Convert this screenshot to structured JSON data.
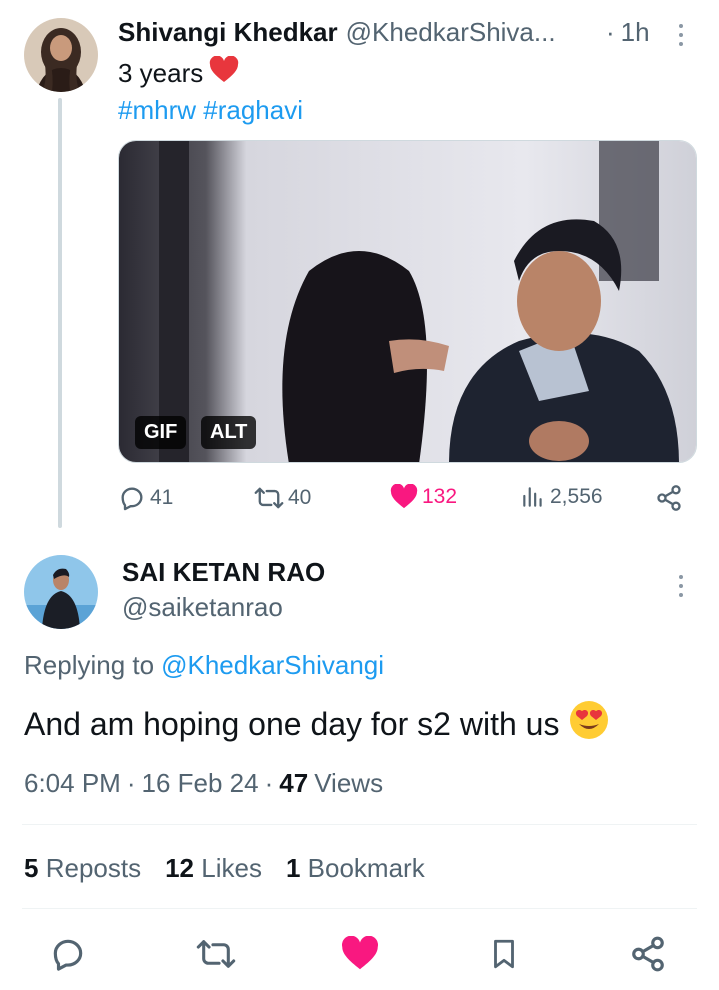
{
  "parent_tweet": {
    "author_name": "Shivangi Khedkar",
    "author_handle": "@KhedkarShiva...",
    "separator": "·",
    "time_ago": "1h",
    "text": "3 years",
    "emoji_heart": "❤️",
    "hashtags": "#mhrw #raghavi",
    "media_badges": {
      "gif": "GIF",
      "alt": "ALT"
    },
    "actions": {
      "replies": "41",
      "reposts": "40",
      "likes": "132",
      "views": "2,556"
    },
    "liked": true
  },
  "reply_tweet": {
    "author_name": "SAI KETAN RAO",
    "author_handle": "@saiketanrao",
    "replying_prefix": "Replying to",
    "replying_handle": "@KhedkarShivangi",
    "text": "And am hoping one day for s2 with us",
    "emoji": "😍",
    "time": "6:04 PM",
    "sep1": "·",
    "date": "16 Feb 24",
    "sep2": "·",
    "views_count": "47",
    "views_label": "Views",
    "stats": {
      "reposts_count": "5",
      "reposts_label": "Reposts",
      "likes_count": "12",
      "likes_label": "Likes",
      "bookmarks_count": "1",
      "bookmarks_label": "Bookmark"
    }
  },
  "colors": {
    "accent": "#1d9bf0",
    "like": "#f91880",
    "muted": "#536471",
    "text": "#0f1419"
  },
  "icons": [
    "more-icon",
    "reply-icon",
    "repost-icon",
    "heart-icon",
    "views-icon",
    "share-icon",
    "bookmark-icon"
  ]
}
